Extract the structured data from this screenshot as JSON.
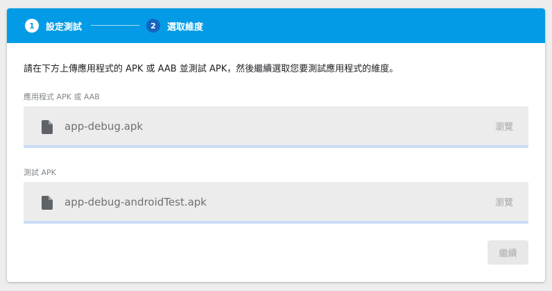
{
  "stepper": {
    "steps": [
      {
        "number": "1",
        "label": "設定測試",
        "state": "completed"
      },
      {
        "number": "2",
        "label": "選取維度",
        "state": "active"
      }
    ]
  },
  "instruction": "請在下方上傳應用程式的 APK 或 AAB 並測試 APK，然後繼續選取您要測試應用程式的維度。",
  "fields": {
    "app": {
      "label": "應用程式 APK 或 AAB",
      "filename": "app-debug.apk",
      "browse_label": "瀏覽",
      "icon": "file-icon"
    },
    "test": {
      "label": "測試 APK",
      "filename": "app-debug-androidTest.apk",
      "browse_label": "瀏覽",
      "icon": "file-icon"
    }
  },
  "actions": {
    "continue_label": "繼續",
    "continue_enabled": false
  },
  "colors": {
    "header": "#039be5",
    "active_step": "#1565c0",
    "field_underline": "#c9dcf7",
    "field_background": "#ececec"
  }
}
